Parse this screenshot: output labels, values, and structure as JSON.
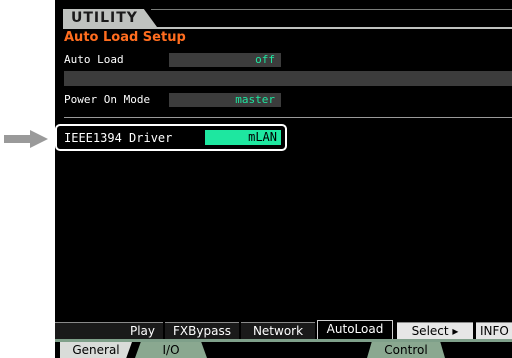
{
  "header": {
    "title": "UTILITY"
  },
  "section": {
    "title": "Auto Load Setup"
  },
  "fields": {
    "auto_load": {
      "label": "Auto Load",
      "value": "off"
    },
    "power_on_mode": {
      "label": "Power On Mode",
      "value": "master"
    },
    "driver": {
      "label": "IEEE1394 Driver",
      "value": "mLAN"
    }
  },
  "tabs": [
    "Play",
    "FXBypass",
    "Network",
    "AutoLoad",
    "Select ▸",
    "INFO"
  ],
  "bottom_tabs": [
    "General",
    "I/O",
    "Control"
  ],
  "colors": {
    "accent_orange": "#ff6d1f",
    "value_green": "#1ee7a0",
    "background": "#000000"
  }
}
